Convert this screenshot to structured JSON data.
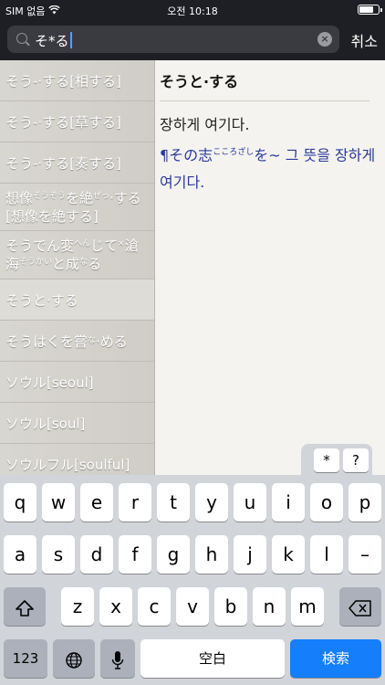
{
  "status": {
    "carrier": "SIM 없음",
    "time": "오전 10:18"
  },
  "search": {
    "query": "そ*る",
    "cancel_label": "취소"
  },
  "list": [
    {
      "label": "そう-·する[相する]"
    },
    {
      "label": "そう-·する[草する]"
    },
    {
      "label": "そう-·する[奏する]"
    },
    {
      "label_a": "想像",
      "furi_a": "そうぞう",
      "label_b": "を絶",
      "furi_b": "ぜっ",
      "label_c": "·する",
      "line2": "[想像を絶する]"
    },
    {
      "label_a": "そうでん変",
      "furi_a": "へん",
      "label_b": "じて",
      "furi_b": "×",
      "label_c": "滄",
      "line2_a": "海",
      "furi_c": "そうかい",
      "line2_b": "と成",
      "furi_d": "な",
      "line2_c": "る"
    },
    {
      "label": "そうと·する"
    },
    {
      "label_a": "そうはくを嘗",
      "furi_a": "な",
      "label_b": "·める"
    },
    {
      "label": "ソウル[seoul]"
    },
    {
      "label": "ソウル[soul]"
    },
    {
      "label": "ソウルフル[soulful]"
    }
  ],
  "detail": {
    "headword": "そうと·する",
    "definition": "장하게 여기다.",
    "example_a": "¶その志",
    "example_furi": "こころざし",
    "example_b": "を~ 그 뜻을 장하게 여기다."
  },
  "keyboard": {
    "symbols": [
      "*",
      "?"
    ],
    "row1": [
      "q",
      "w",
      "e",
      "r",
      "t",
      "y",
      "u",
      "i",
      "o",
      "p"
    ],
    "row2": [
      "a",
      "s",
      "d",
      "f",
      "g",
      "h",
      "j",
      "k",
      "l",
      "–"
    ],
    "row3": [
      "z",
      "x",
      "c",
      "v",
      "b",
      "n",
      "m"
    ],
    "numbers_label": "123",
    "space_label": "空白",
    "search_label": "検索"
  },
  "colors": {
    "accent": "#2a3a9c",
    "search_key": "#147efb",
    "caret": "#4aa3ff"
  }
}
